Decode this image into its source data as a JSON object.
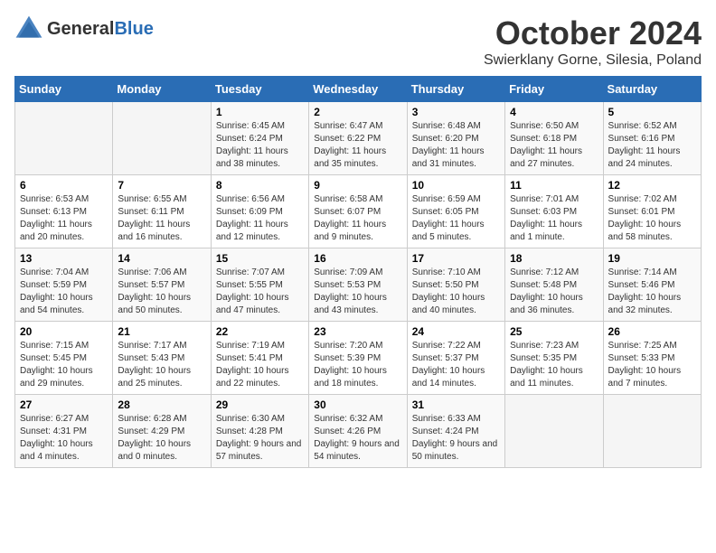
{
  "header": {
    "logo_line1": "General",
    "logo_line2": "Blue",
    "month": "October 2024",
    "location": "Swierklany Gorne, Silesia, Poland"
  },
  "days_of_week": [
    "Sunday",
    "Monday",
    "Tuesday",
    "Wednesday",
    "Thursday",
    "Friday",
    "Saturday"
  ],
  "weeks": [
    [
      {
        "day": "",
        "info": ""
      },
      {
        "day": "",
        "info": ""
      },
      {
        "day": "1",
        "info": "Sunrise: 6:45 AM\nSunset: 6:24 PM\nDaylight: 11 hours and 38 minutes."
      },
      {
        "day": "2",
        "info": "Sunrise: 6:47 AM\nSunset: 6:22 PM\nDaylight: 11 hours and 35 minutes."
      },
      {
        "day": "3",
        "info": "Sunrise: 6:48 AM\nSunset: 6:20 PM\nDaylight: 11 hours and 31 minutes."
      },
      {
        "day": "4",
        "info": "Sunrise: 6:50 AM\nSunset: 6:18 PM\nDaylight: 11 hours and 27 minutes."
      },
      {
        "day": "5",
        "info": "Sunrise: 6:52 AM\nSunset: 6:16 PM\nDaylight: 11 hours and 24 minutes."
      }
    ],
    [
      {
        "day": "6",
        "info": "Sunrise: 6:53 AM\nSunset: 6:13 PM\nDaylight: 11 hours and 20 minutes."
      },
      {
        "day": "7",
        "info": "Sunrise: 6:55 AM\nSunset: 6:11 PM\nDaylight: 11 hours and 16 minutes."
      },
      {
        "day": "8",
        "info": "Sunrise: 6:56 AM\nSunset: 6:09 PM\nDaylight: 11 hours and 12 minutes."
      },
      {
        "day": "9",
        "info": "Sunrise: 6:58 AM\nSunset: 6:07 PM\nDaylight: 11 hours and 9 minutes."
      },
      {
        "day": "10",
        "info": "Sunrise: 6:59 AM\nSunset: 6:05 PM\nDaylight: 11 hours and 5 minutes."
      },
      {
        "day": "11",
        "info": "Sunrise: 7:01 AM\nSunset: 6:03 PM\nDaylight: 11 hours and 1 minute."
      },
      {
        "day": "12",
        "info": "Sunrise: 7:02 AM\nSunset: 6:01 PM\nDaylight: 10 hours and 58 minutes."
      }
    ],
    [
      {
        "day": "13",
        "info": "Sunrise: 7:04 AM\nSunset: 5:59 PM\nDaylight: 10 hours and 54 minutes."
      },
      {
        "day": "14",
        "info": "Sunrise: 7:06 AM\nSunset: 5:57 PM\nDaylight: 10 hours and 50 minutes."
      },
      {
        "day": "15",
        "info": "Sunrise: 7:07 AM\nSunset: 5:55 PM\nDaylight: 10 hours and 47 minutes."
      },
      {
        "day": "16",
        "info": "Sunrise: 7:09 AM\nSunset: 5:53 PM\nDaylight: 10 hours and 43 minutes."
      },
      {
        "day": "17",
        "info": "Sunrise: 7:10 AM\nSunset: 5:50 PM\nDaylight: 10 hours and 40 minutes."
      },
      {
        "day": "18",
        "info": "Sunrise: 7:12 AM\nSunset: 5:48 PM\nDaylight: 10 hours and 36 minutes."
      },
      {
        "day": "19",
        "info": "Sunrise: 7:14 AM\nSunset: 5:46 PM\nDaylight: 10 hours and 32 minutes."
      }
    ],
    [
      {
        "day": "20",
        "info": "Sunrise: 7:15 AM\nSunset: 5:45 PM\nDaylight: 10 hours and 29 minutes."
      },
      {
        "day": "21",
        "info": "Sunrise: 7:17 AM\nSunset: 5:43 PM\nDaylight: 10 hours and 25 minutes."
      },
      {
        "day": "22",
        "info": "Sunrise: 7:19 AM\nSunset: 5:41 PM\nDaylight: 10 hours and 22 minutes."
      },
      {
        "day": "23",
        "info": "Sunrise: 7:20 AM\nSunset: 5:39 PM\nDaylight: 10 hours and 18 minutes."
      },
      {
        "day": "24",
        "info": "Sunrise: 7:22 AM\nSunset: 5:37 PM\nDaylight: 10 hours and 14 minutes."
      },
      {
        "day": "25",
        "info": "Sunrise: 7:23 AM\nSunset: 5:35 PM\nDaylight: 10 hours and 11 minutes."
      },
      {
        "day": "26",
        "info": "Sunrise: 7:25 AM\nSunset: 5:33 PM\nDaylight: 10 hours and 7 minutes."
      }
    ],
    [
      {
        "day": "27",
        "info": "Sunrise: 6:27 AM\nSunset: 4:31 PM\nDaylight: 10 hours and 4 minutes."
      },
      {
        "day": "28",
        "info": "Sunrise: 6:28 AM\nSunset: 4:29 PM\nDaylight: 10 hours and 0 minutes."
      },
      {
        "day": "29",
        "info": "Sunrise: 6:30 AM\nSunset: 4:28 PM\nDaylight: 9 hours and 57 minutes."
      },
      {
        "day": "30",
        "info": "Sunrise: 6:32 AM\nSunset: 4:26 PM\nDaylight: 9 hours and 54 minutes."
      },
      {
        "day": "31",
        "info": "Sunrise: 6:33 AM\nSunset: 4:24 PM\nDaylight: 9 hours and 50 minutes."
      },
      {
        "day": "",
        "info": ""
      },
      {
        "day": "",
        "info": ""
      }
    ]
  ]
}
